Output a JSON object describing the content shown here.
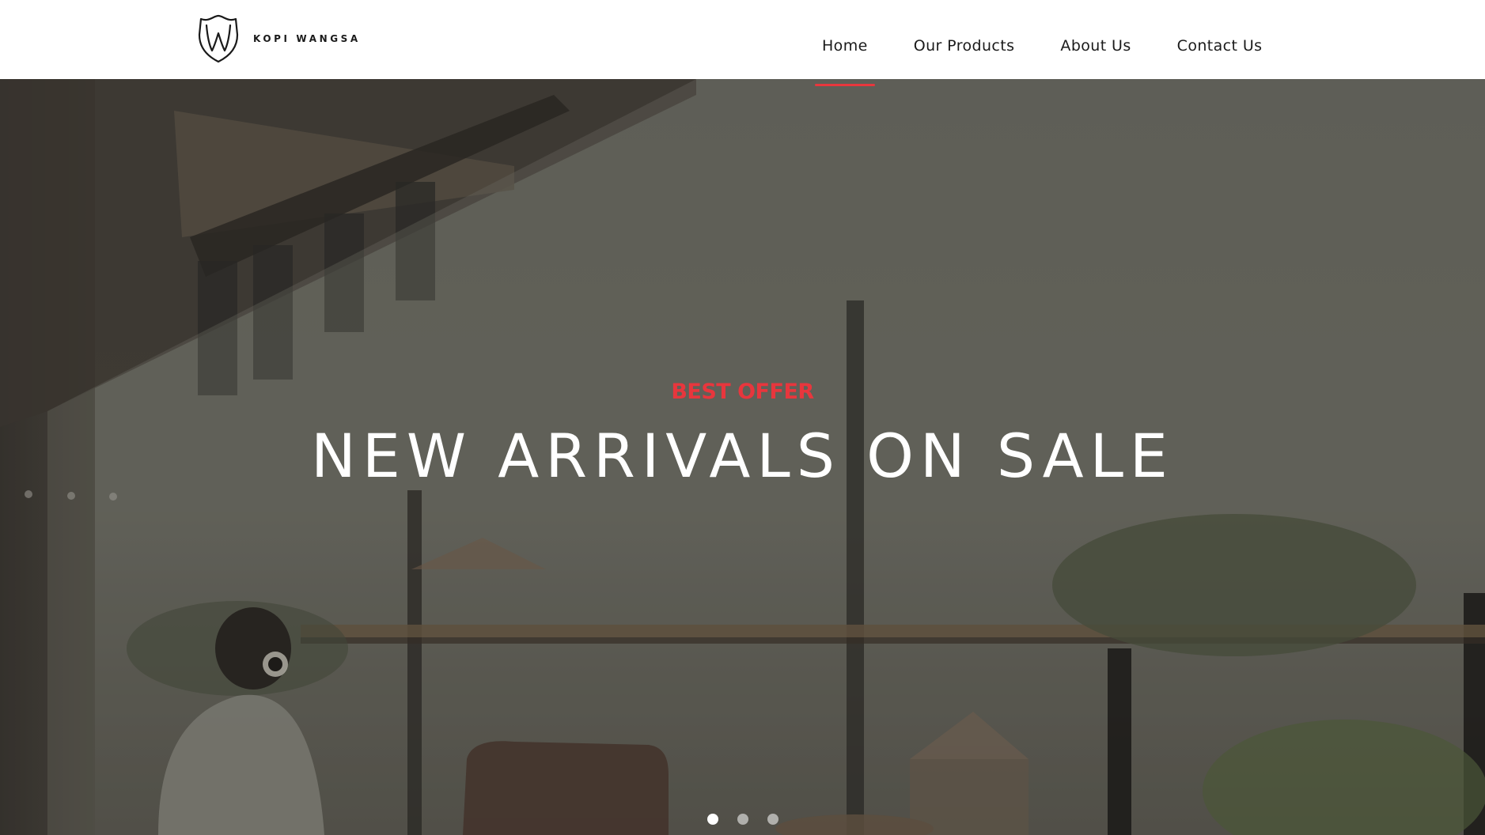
{
  "brand": {
    "name": "KOPI WANGSA",
    "logo_icon": "shield-w-icon"
  },
  "nav": {
    "items": [
      {
        "label": "Home",
        "active": true
      },
      {
        "label": "Our Products",
        "active": false
      },
      {
        "label": "About Us",
        "active": false
      },
      {
        "label": "Contact Us",
        "active": false
      }
    ]
  },
  "hero": {
    "subtitle": "BEST OFFER",
    "title": "NEW ARRIVALS ON SALE",
    "slides": {
      "count": 3,
      "active_index": 0
    }
  },
  "colors": {
    "accent": "#e8363d",
    "header_bg": "#ffffff",
    "text_dark": "#1a1a1a",
    "hero_text": "#ffffff"
  }
}
